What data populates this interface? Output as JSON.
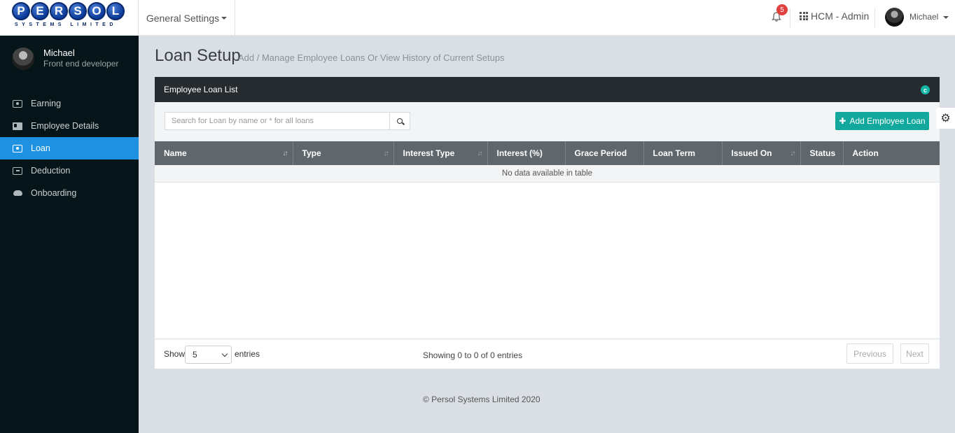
{
  "brand": {
    "letters": [
      "P",
      "E",
      "R",
      "S",
      "O",
      "L"
    ],
    "subtitle": "SYSTEMS LIMITED"
  },
  "header": {
    "settings_menu": "General Settings",
    "notification_count": "5",
    "app_switcher": "HCM - Admin",
    "user_name": "Michael"
  },
  "sidebar": {
    "user_name": "Michael",
    "user_role": "Front end developer",
    "items": [
      {
        "label": "Earning",
        "icon": "money-icon"
      },
      {
        "label": "Employee Details",
        "icon": "id-card-icon"
      },
      {
        "label": "Loan",
        "icon": "money-icon",
        "active": true
      },
      {
        "label": "Deduction",
        "icon": "minus-square-icon"
      },
      {
        "label": "Onboarding",
        "icon": "cloud-upload-icon"
      }
    ]
  },
  "page": {
    "title": "Loan Setup",
    "subtitle": "Add / Manage Employee Loans Or View History of Current Setups"
  },
  "panel": {
    "title": "Employee Loan List",
    "search_placeholder": "Search for Loan by name or * for all loans",
    "add_button": "Add Employee Loan",
    "columns": [
      "Name",
      "Type",
      "Interest Type",
      "Interest (%)",
      "Grace Period",
      "Loan Term",
      "Issued On",
      "Status",
      "Action"
    ],
    "empty_message": "No data available in table",
    "footer": {
      "show_label": "Show",
      "page_size": "5",
      "entries_label": "entries",
      "info": "Showing 0 to 0 of 0 entries",
      "previous": "Previous",
      "next": "Next"
    }
  },
  "copyright": "© Persol Systems Limited 2020",
  "colors": {
    "accent": "#12a89d",
    "active_nav": "#1e91e0",
    "sidebar_bg": "#061519",
    "badge": "#e0413f"
  }
}
